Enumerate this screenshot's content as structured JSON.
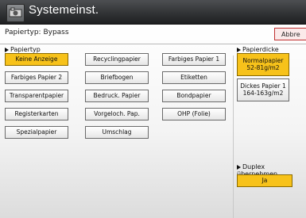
{
  "window": {
    "title": "Systemeinst."
  },
  "header": {
    "paper_type_info": "Papiertyp: Bypass",
    "abort_label": "Abbre"
  },
  "paper_type_section": {
    "label": "Papiertyp",
    "selected": "Keine Anzeige",
    "buttons": [
      "Keine Anzeige",
      "Recyclingpapier",
      "Farbiges Papier 1",
      "Farbiges Papier 2",
      "Briefbogen",
      "Etiketten",
      "Transparentpapier",
      "Bedruck. Papier",
      "Bondpapier",
      "Registerkarten",
      "Vorgeloch. Pap.",
      "OHP (Folie)",
      "Spezialpapier",
      "Umschlag"
    ]
  },
  "paper_thickness_section": {
    "label": "Papierdicke",
    "options": [
      {
        "line1": "Normalpapier",
        "line2": "52-81g/m2",
        "selected": true
      },
      {
        "line1": "Dickes Papier 1",
        "line2": "164-163g/m2",
        "selected": false
      }
    ]
  },
  "duplex_section": {
    "label": "Duplex übernehmen",
    "value": "Ja"
  },
  "colors": {
    "accent": "#f7c21a",
    "titlebar": "#2f3133",
    "abort_border": "#c03030"
  }
}
